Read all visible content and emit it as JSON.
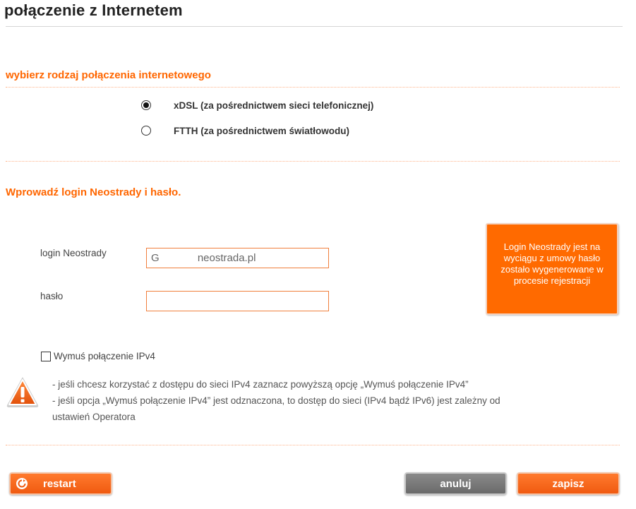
{
  "header": {
    "title": "połączenie z Internetem"
  },
  "connection_type": {
    "heading": "wybierz rodzaj połączenia internetowego",
    "options": [
      {
        "label": "xDSL (za pośrednictwem sieci telefonicznej)",
        "selected": true
      },
      {
        "label": "FTTH (za pośrednictwem światłowodu)",
        "selected": false
      }
    ]
  },
  "credentials": {
    "heading": "Wprowadź login Neostrady i hasło.",
    "login_label": "login Neostrady",
    "login_value": "G             neostrada.pl",
    "password_label": "hasło",
    "password_value": ""
  },
  "info_box": {
    "text": "Login Neostrady jest na wyciągu z umowy hasło zostało wygenerowane w procesie rejestracji"
  },
  "ipv4": {
    "checkbox_label": "Wymuś połączenie IPv4",
    "checked": false
  },
  "warning": {
    "icon": "warning-triangle-icon",
    "line1": "- jeśli chcesz korzystać z dostępu do sieci IPv4 zaznacz powyższą opcję „Wymuś połączenie IPv4”",
    "line2": "- jeśli opcja „Wymuś połączenie IPv4” jest odznaczona, to dostęp do sieci (IPv4 bądź IPv6) jest zależny od",
    "line3": "ustawień Operatora"
  },
  "buttons": {
    "restart_label": "restart",
    "cancel_label": "anuluj",
    "save_label": "zapisz"
  },
  "colors": {
    "accent": "#ff6600",
    "button_gray": "#7a7a7a"
  }
}
